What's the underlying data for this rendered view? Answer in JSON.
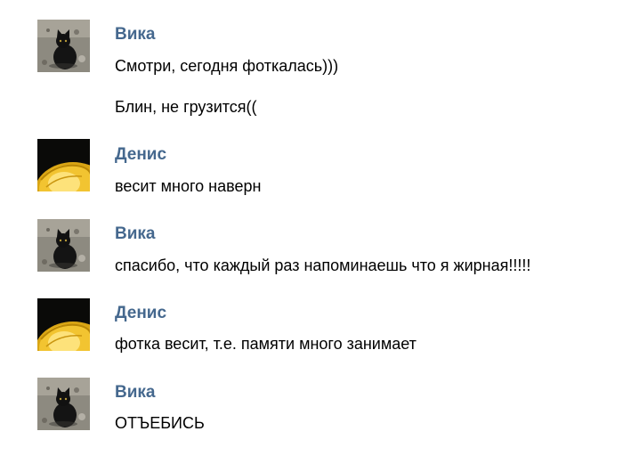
{
  "messages": [
    {
      "author": "Вика",
      "avatar_icon": "black-cat-on-gravel-avatar",
      "lines": [
        "Смотри, сегодня фоткалась)))",
        "Блин, не грузится(("
      ]
    },
    {
      "author": "Денис",
      "avatar_icon": "yellow-helmet-avatar",
      "lines": [
        "весит много наверн"
      ]
    },
    {
      "author": "Вика",
      "avatar_icon": "black-cat-on-gravel-avatar",
      "lines": [
        "спасибо, что каждый раз напоминаешь что я жирная!!!!!"
      ]
    },
    {
      "author": "Денис",
      "avatar_icon": "yellow-helmet-avatar",
      "lines": [
        "фотка весит, т.е. памяти много занимает"
      ]
    },
    {
      "author": "Вика",
      "avatar_icon": "black-cat-on-gravel-avatar",
      "lines": [
        "ОТЪЕБИСЬ"
      ]
    }
  ],
  "colors": {
    "author_name": "#45688e",
    "message_text": "#000000",
    "background": "#ffffff"
  }
}
